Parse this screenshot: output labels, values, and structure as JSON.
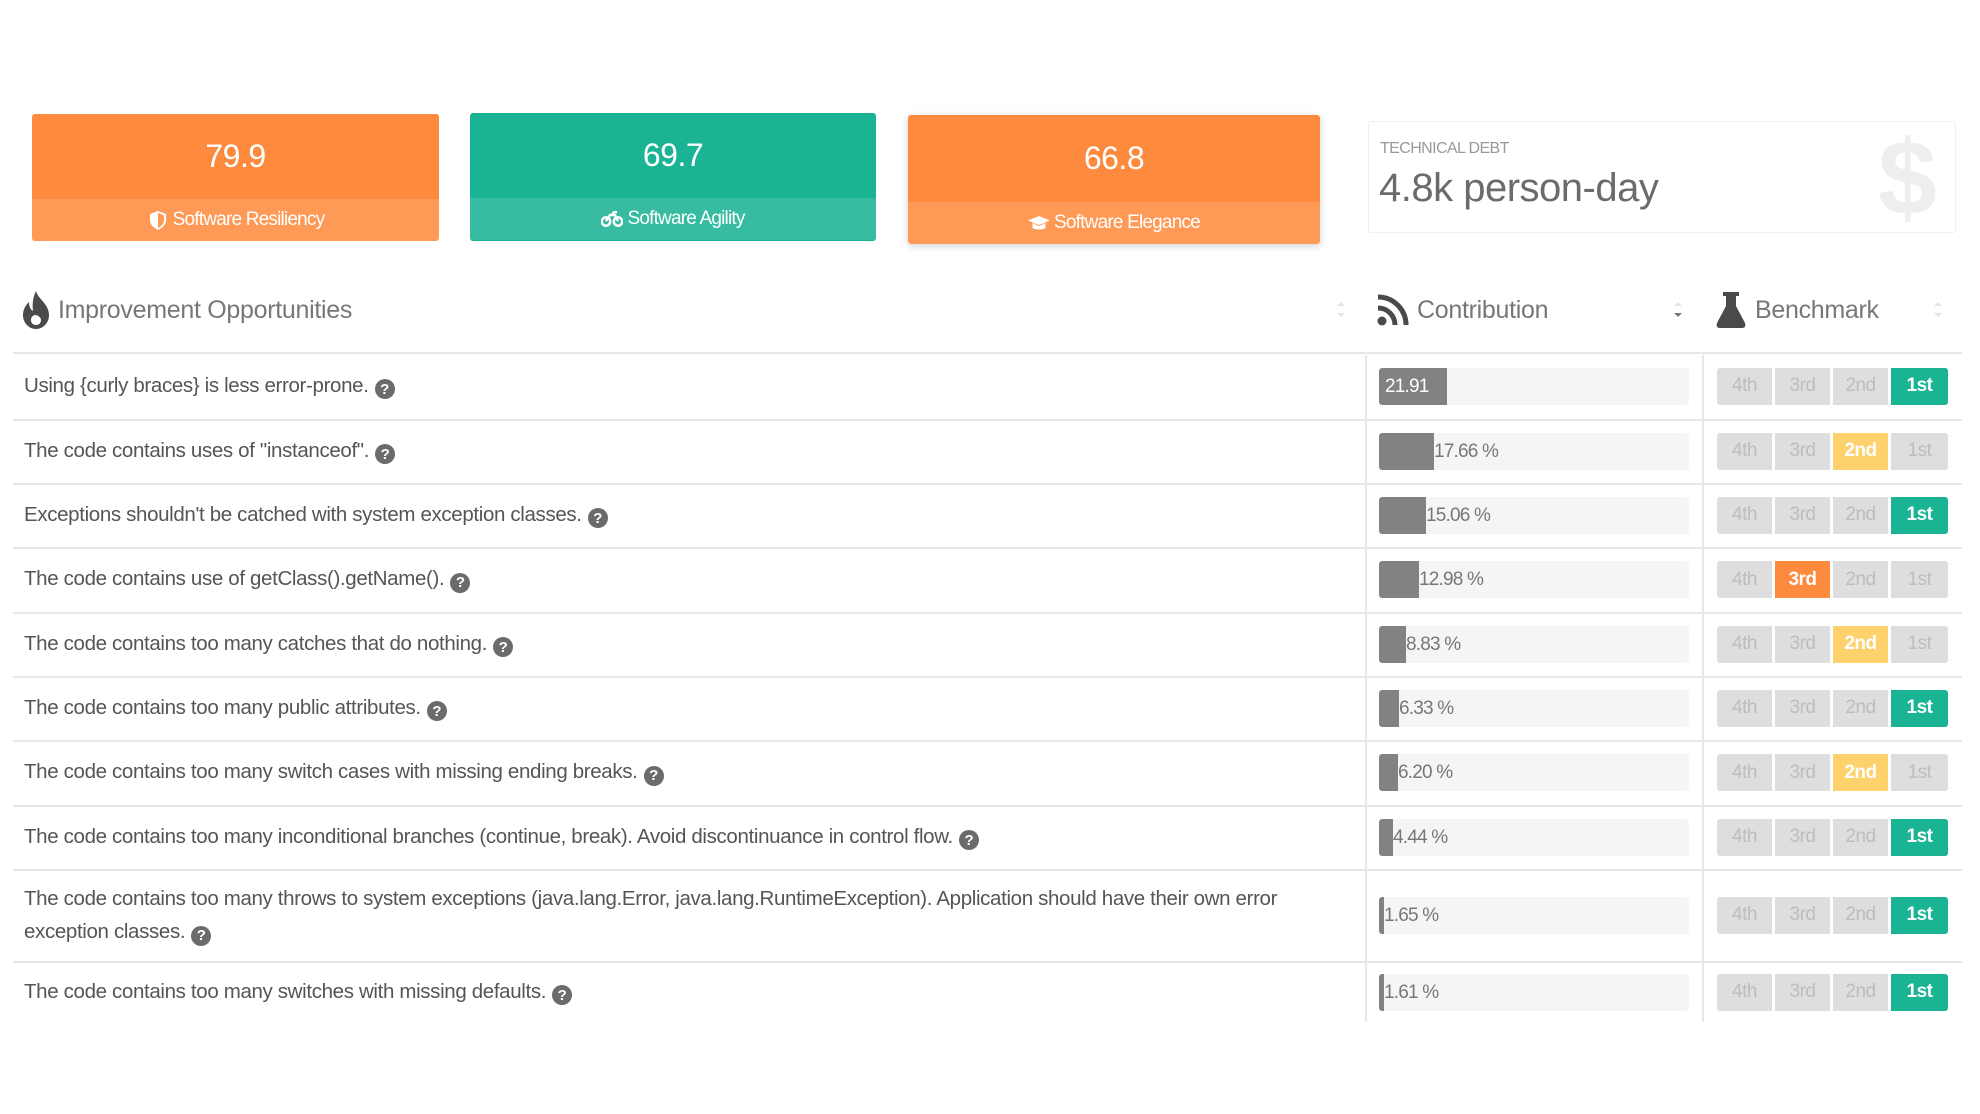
{
  "cards": [
    {
      "value": "79.9",
      "label": "Software Resiliency",
      "icon": "shield-icon",
      "color": "#fe8a3d"
    },
    {
      "value": "69.7",
      "label": "Software Agility",
      "icon": "motorcycle-icon",
      "color": "#1ab394"
    },
    {
      "value": "66.8",
      "label": "Software Elegance",
      "icon": "graduation-cap-icon",
      "color": "#fe8a3d"
    }
  ],
  "technical_debt": {
    "label": "TECHNICAL DEBT",
    "value": "4.8k person-day",
    "icon": "dollar-icon"
  },
  "table": {
    "headers": {
      "opportunities": "Improvement Opportunities",
      "contribution": "Contribution",
      "benchmark": "Benchmark"
    },
    "header_icons": {
      "opportunities": "fire-icon",
      "contribution": "rss-icon",
      "benchmark": "flask-icon"
    },
    "sort": {
      "column": "contribution",
      "direction": "descending"
    },
    "benchmark_levels": [
      "4th",
      "3rd",
      "2nd",
      "1st"
    ],
    "benchmark_colors": {
      "1st": "#1ab394",
      "2nd": "#fdd26d",
      "3rd": "#fe8a3d"
    },
    "rows": [
      {
        "text": "Using {curly braces} is less error-prone.",
        "contribution": 21.91,
        "contribution_label": "21.91",
        "benchmark": "1st"
      },
      {
        "text": "The code contains uses of \"instanceof\".",
        "contribution": 17.66,
        "contribution_label": "17.66 %",
        "benchmark": "2nd"
      },
      {
        "text": "Exceptions shouldn't be catched with system exception classes.",
        "contribution": 15.06,
        "contribution_label": "15.06 %",
        "benchmark": "1st"
      },
      {
        "text": "The code contains use of getClass().getName().",
        "contribution": 12.98,
        "contribution_label": "12.98 %",
        "benchmark": "3rd"
      },
      {
        "text": "The code contains too many catches that do nothing.",
        "contribution": 8.83,
        "contribution_label": "8.83 %",
        "benchmark": "2nd"
      },
      {
        "text": "The code contains too many public attributes.",
        "contribution": 6.33,
        "contribution_label": "6.33 %",
        "benchmark": "1st"
      },
      {
        "text": "The code contains too many switch cases with missing ending breaks.",
        "contribution": 6.2,
        "contribution_label": "6.20 %",
        "benchmark": "2nd"
      },
      {
        "text": "The code contains too many inconditional branches (continue, break). Avoid discontinuance in control flow.",
        "contribution": 4.44,
        "contribution_label": "4.44 %",
        "benchmark": "1st"
      },
      {
        "text": "The code contains too many throws to system exceptions (java.lang.Error, java.lang.RuntimeException). Application should have their own error exception classes.",
        "contribution": 1.65,
        "contribution_label": "1.65 %",
        "benchmark": "1st"
      },
      {
        "text": "The code contains too many switches with missing defaults.",
        "contribution": 1.61,
        "contribution_label": "1.61 %",
        "benchmark": "1st"
      }
    ],
    "help_icon": "question-circle-icon",
    "help_glyph": "?"
  }
}
